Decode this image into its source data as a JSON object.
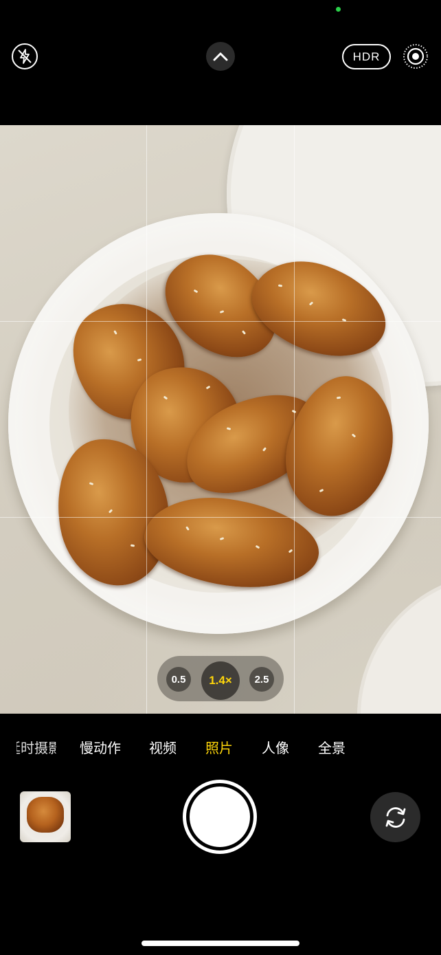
{
  "top_bar": {
    "hdr_label": "HDR"
  },
  "viewfinder": {
    "subject": "plate-of-braised-chicken-wings"
  },
  "zoom": {
    "options": [
      "0.5",
      "1.4×",
      "2.5"
    ],
    "selected": "1.4×"
  },
  "modes": {
    "items": [
      "延时摄影",
      "慢动作",
      "视频",
      "照片",
      "人像",
      "全景"
    ],
    "selected": "照片"
  },
  "icons": {
    "flash": "flash-off-icon",
    "chevron": "chevron-up-icon",
    "live": "live-photo-icon",
    "flip": "camera-flip-icon"
  },
  "colors": {
    "accent": "#ffd60a",
    "status_dot": "#2bd14a",
    "background": "#000000"
  }
}
